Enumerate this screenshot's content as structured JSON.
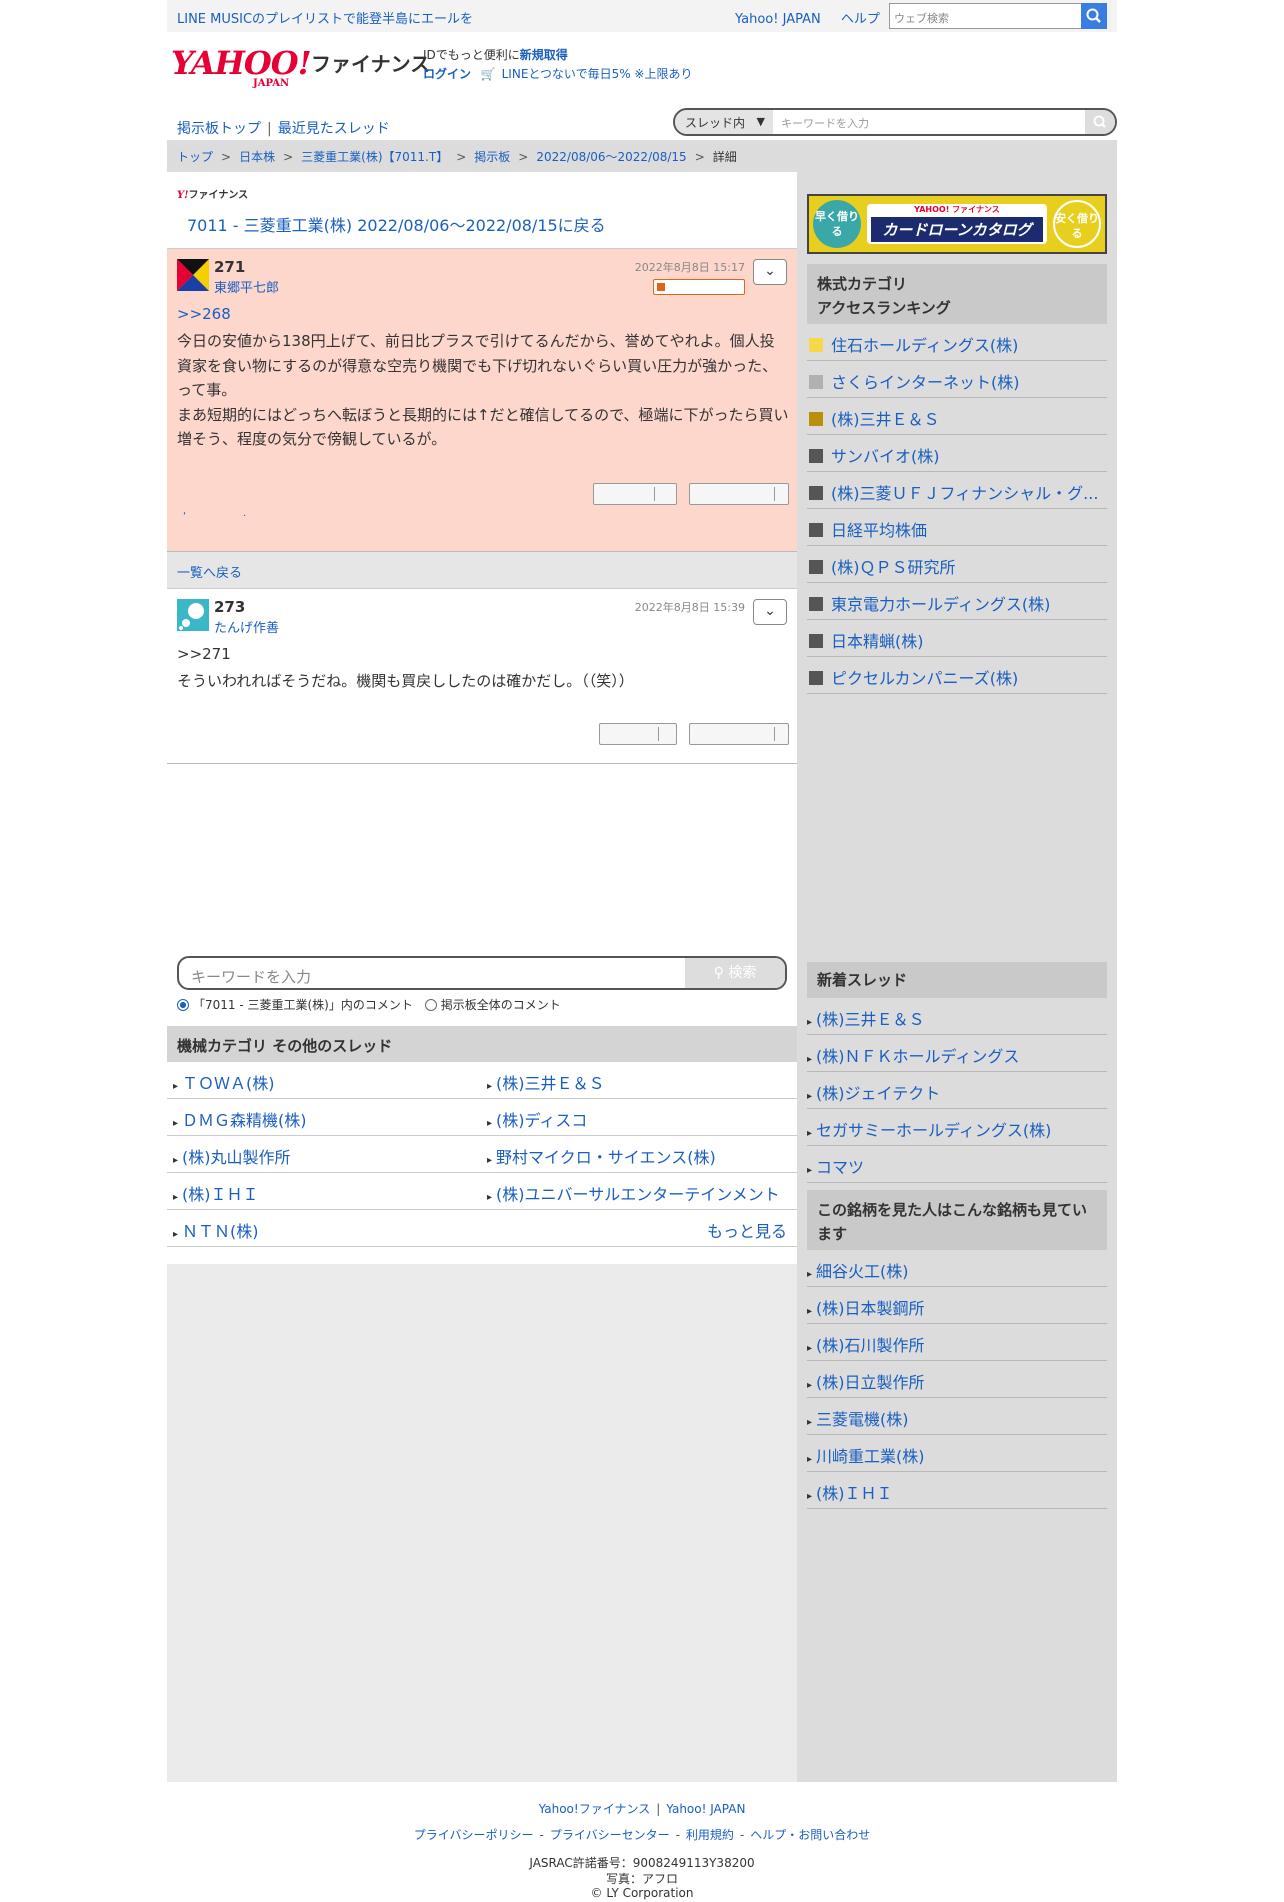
{
  "topbar": {
    "promo": "LINE MUSICのプレイリストで能登半島にエールを",
    "links": [
      "Yahoo! JAPAN",
      "ヘルプ"
    ],
    "search_placeholder": "ウェブ検索"
  },
  "header": {
    "logo": "YAHOO!",
    "logo_sub": "JAPAN",
    "service": "ファイナンス",
    "id_text": "IDでもっと便利に",
    "id_link": "新規取得",
    "login": "ログイン",
    "line_promo": "LINEとつないで毎日5% ※上限あり"
  },
  "boardnav": {
    "top": "掲示板トップ",
    "recent": "最近見たスレッド",
    "scope": "スレッド内",
    "placeholder": "キーワードを入力"
  },
  "breadcrumb": [
    "トップ",
    "日本株",
    "三菱重工業(株)【7011.T】",
    "掲示板",
    "2022/08/06〜2022/08/15",
    "詳細"
  ],
  "main": {
    "small_logo_y": "Y!",
    "small_logo_t": "ファイナンス",
    "back": "7011 - 三菱重工業(株) 2022/08/06〜2022/08/15に戻る",
    "list_back": "一覧へ戻る"
  },
  "posts": [
    {
      "number": "271",
      "author": "東郷平七郎",
      "date": "2022年8月8日 15:17",
      "reply_to": ">>268",
      "body": "今日の安値から138円上げて、前日比プラスで引けてるんだから、誉めてやれよ。個人投資家を食い物にするのが得意な空売り機関でも下げ切れないぐらい買い圧力が強かった、って事。\nまあ短期的にはどっちへ転ぼうと長期的には↑だと確信してるので、極端に下がったら買い増そう、程度の気分で傍観しているが。"
    },
    {
      "number": "273",
      "author": "たんげ作善",
      "date": "2022年8月8日 15:39",
      "reply_to": ">>271",
      "body": "そういわれればそうだね。機関も買戻ししたのは確かだし。（（笑））"
    }
  ],
  "keyword_search": {
    "placeholder": "キーワードを入力",
    "button": "検索",
    "radio1": "「7011 - 三菱重工業(株)」内のコメント",
    "radio2": "掲示板全体のコメント"
  },
  "category": {
    "title": "機械カテゴリ  その他のスレッド",
    "rows": [
      [
        "ＴＯＷＡ(株)",
        "(株)三井Ｅ＆Ｓ"
      ],
      [
        "ＤＭＧ森精機(株)",
        "(株)ディスコ"
      ],
      [
        "(株)丸山製作所",
        "野村マイクロ・サイエンス(株)"
      ],
      [
        "(株)ＩＨＩ",
        "(株)ユニバーサルエンターテインメント"
      ],
      [
        "ＮＴＮ(株)",
        ""
      ]
    ],
    "more": "もっと見る"
  },
  "sidebar": {
    "banner": {
      "left": "早く借りる",
      "brand": "YAHOO! ファイナンス",
      "title": "カードローンカタログ",
      "right": "安く借りる"
    },
    "ranking_title": "株式カテゴリ\nアクセスランキング",
    "ranking": [
      {
        "name": "住石ホールディングス(株)",
        "color": "#f5d94a"
      },
      {
        "name": "さくらインターネット(株)",
        "color": "#b0b0b0"
      },
      {
        "name": "(株)三井Ｅ＆Ｓ",
        "color": "#b8900e"
      },
      {
        "name": "サンバイオ(株)",
        "color": "#555555"
      },
      {
        "name": "(株)三菱ＵＦＪフィナンシャル・グ...",
        "color": "#555555"
      },
      {
        "name": "日経平均株価",
        "color": "#555555"
      },
      {
        "name": "(株)ＱＰＳ研究所",
        "color": "#555555"
      },
      {
        "name": "東京電力ホールディングス(株)",
        "color": "#555555"
      },
      {
        "name": "日本精蝋(株)",
        "color": "#555555"
      },
      {
        "name": "ピクセルカンパニーズ(株)",
        "color": "#555555"
      }
    ],
    "new_threads_title": "新着スレッド",
    "new_threads": [
      "(株)三井Ｅ＆Ｓ",
      "(株)ＮＦＫホールディングス",
      "(株)ジェイテクト",
      "セガサミーホールディングス(株)",
      "コマツ"
    ],
    "also_viewed_title": "この銘柄を見た人はこんな銘柄も見ています",
    "also_viewed": [
      "細谷火工(株)",
      "(株)日本製鋼所",
      "(株)石川製作所",
      "(株)日立製作所",
      "三菱電機(株)",
      "川崎重工業(株)",
      "(株)ＩＨＩ"
    ]
  },
  "footer": {
    "row1": [
      "Yahoo!ファイナンス",
      "Yahoo! JAPAN"
    ],
    "row2": [
      "プライバシーポリシー",
      "プライバシーセンター",
      "利用規約",
      "ヘルプ・お問い合わせ"
    ],
    "jasrac": "JASRAC許諾番号：9008249113Y38200",
    "photo": "写真：アフロ",
    "copyright": "© LY Corporation"
  }
}
